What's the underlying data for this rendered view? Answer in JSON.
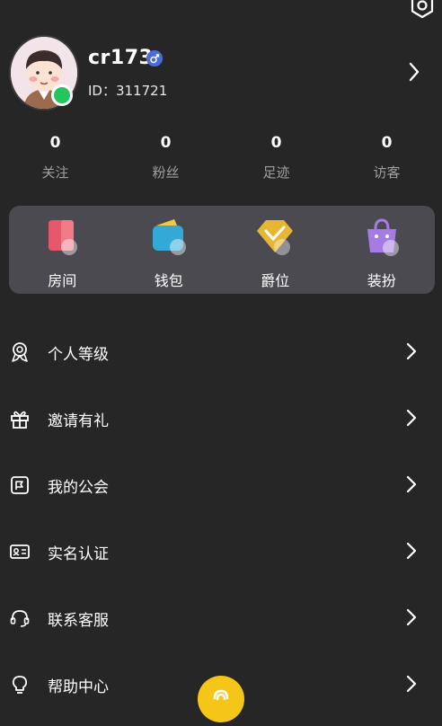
{
  "profile": {
    "username": "cr173",
    "gender_icon": "male-icon",
    "user_id": "ID：311721",
    "online_color": "#22c55e"
  },
  "stats": [
    {
      "value": "0",
      "label": "关注"
    },
    {
      "value": "0",
      "label": "粉丝"
    },
    {
      "value": "0",
      "label": "足迹"
    },
    {
      "value": "0",
      "label": "访客"
    }
  ],
  "features": [
    {
      "label": "房间",
      "icon": "room-icon",
      "color": "#e5586a"
    },
    {
      "label": "钱包",
      "icon": "wallet-icon",
      "color": "#35a9d6"
    },
    {
      "label": "爵位",
      "icon": "noble-icon",
      "color": "#e7b632"
    },
    {
      "label": "装扮",
      "icon": "dress-up-icon",
      "color": "#a77be4"
    }
  ],
  "menu": [
    {
      "label": "个人等级",
      "icon": "medal-icon"
    },
    {
      "label": "邀请有礼",
      "icon": "gift-icon"
    },
    {
      "label": "我的公会",
      "icon": "guild-icon"
    },
    {
      "label": "实名认证",
      "icon": "id-card-icon"
    },
    {
      "label": "联系客服",
      "icon": "headset-icon"
    },
    {
      "label": "帮助中心",
      "icon": "lightbulb-icon"
    }
  ],
  "fab_color": "#f5c518"
}
